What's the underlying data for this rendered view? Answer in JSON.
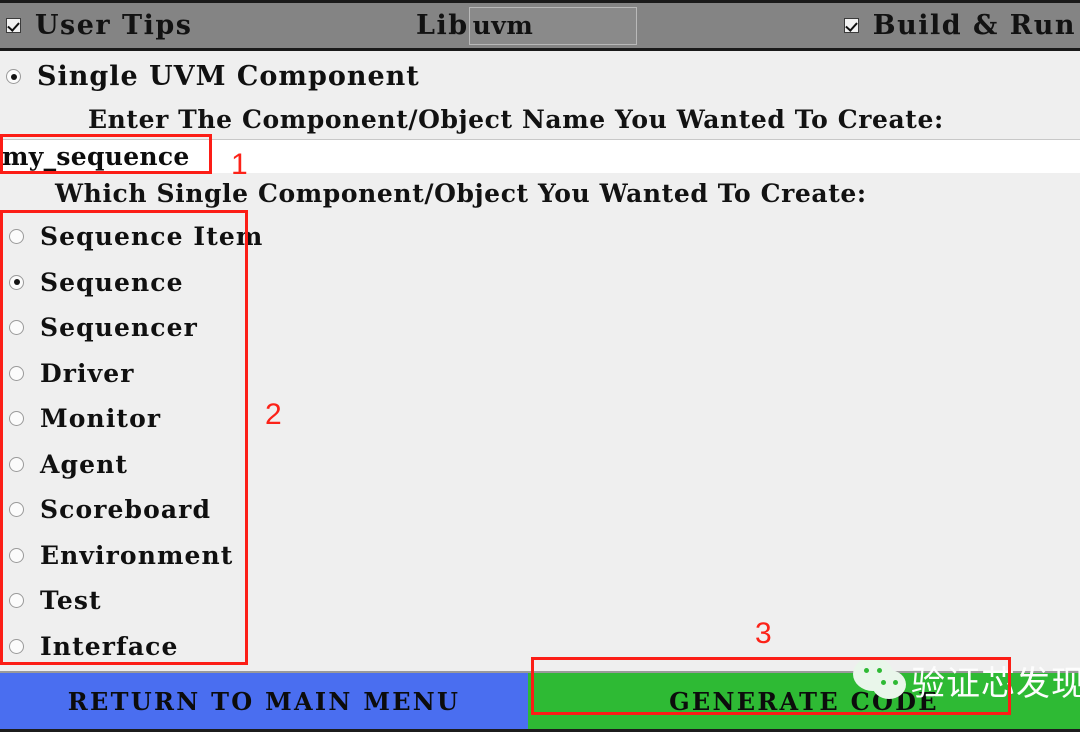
{
  "topbar": {
    "user_tips": {
      "label": "User Tips",
      "checked": true,
      "icon": "checkbox-checked-icon"
    },
    "lib": {
      "label": "Lib",
      "value": "uvm",
      "placeholder": ""
    },
    "build_run": {
      "label": "Build & Run",
      "checked": true,
      "icon": "checkbox-checked-icon"
    }
  },
  "main": {
    "mode_option": {
      "label": "Single UVM Component",
      "selected": true
    },
    "prompt_name": "Enter The Component/Object Name You Wanted To Create:",
    "name_input": {
      "value": "my_sequence",
      "placeholder": ""
    },
    "prompt_type": "Which Single Component/Object You Wanted To Create:",
    "options": [
      {
        "label": "Sequence Item",
        "selected": false
      },
      {
        "label": "Sequence",
        "selected": true
      },
      {
        "label": "Sequencer",
        "selected": false
      },
      {
        "label": "Driver",
        "selected": false
      },
      {
        "label": "Monitor",
        "selected": false
      },
      {
        "label": "Agent",
        "selected": false
      },
      {
        "label": "Scoreboard",
        "selected": false
      },
      {
        "label": "Environment",
        "selected": false
      },
      {
        "label": "Test",
        "selected": false
      },
      {
        "label": "Interface",
        "selected": false
      }
    ]
  },
  "footer": {
    "return_button": "RETURN TO MAIN MENU",
    "generate_button": "GENERATE CODE"
  },
  "annotations": [
    {
      "number": "1",
      "target": "name-input"
    },
    {
      "number": "2",
      "target": "component-type-list"
    },
    {
      "number": "3",
      "target": "generate-code-button"
    }
  ],
  "watermark": {
    "text": "验证芯发现",
    "icon": "wechat-logo-icon"
  },
  "colors": {
    "topbar_bg": "#848484",
    "content_bg": "#efefef",
    "return_button": "#4a6ef0",
    "generate_button": "#2eba34",
    "annotation_red": "#fc1d16"
  }
}
